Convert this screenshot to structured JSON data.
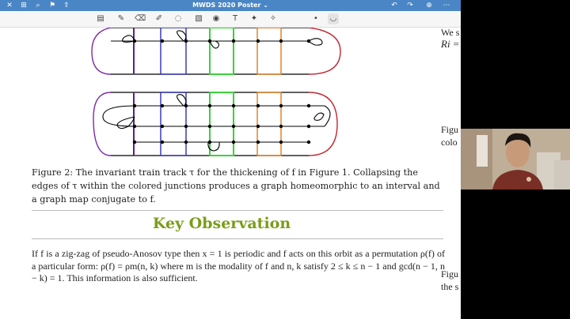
{
  "window": {
    "title": "MWDS 2020 Poster",
    "title_chevron": "⌄"
  },
  "titlebar_left": [
    {
      "name": "close-icon",
      "glyph": "✕"
    },
    {
      "name": "grid-icon",
      "glyph": "⊞"
    },
    {
      "name": "search-icon",
      "glyph": "⌕"
    },
    {
      "name": "bookmark-icon",
      "glyph": "⚑"
    },
    {
      "name": "share-icon",
      "glyph": "⇪"
    }
  ],
  "titlebar_right": [
    {
      "name": "undo-icon",
      "glyph": "↶"
    },
    {
      "name": "redo-icon",
      "glyph": "↷"
    },
    {
      "name": "add-page-icon",
      "glyph": "⊕"
    },
    {
      "name": "more-icon",
      "glyph": "⋯"
    }
  ],
  "toolbar": [
    {
      "name": "reader-icon",
      "glyph": "▤"
    },
    {
      "name": "pen-icon",
      "glyph": "✎"
    },
    {
      "name": "eraser-icon",
      "glyph": "⌫"
    },
    {
      "name": "highlighter-icon",
      "glyph": "✐"
    },
    {
      "name": "lasso-icon",
      "glyph": "◌"
    },
    {
      "name": "image-icon",
      "glyph": "▧"
    },
    {
      "name": "camera-icon",
      "glyph": "◉"
    },
    {
      "name": "text-icon",
      "glyph": "T"
    },
    {
      "name": "laser-icon",
      "glyph": "✦"
    },
    {
      "name": "color-dot-icon",
      "glyph": "•"
    },
    {
      "name": "thickness-icon",
      "glyph": "◡"
    }
  ],
  "caption": "Figure 2: The invariant train track τ for the thickening of f in Figure 1. Collapsing the edges of τ within the colored junctions produces a graph homeomorphic to an interval and a graph map conjugate to f.",
  "key_observation": "Key Observation",
  "body": "If f is a zig-zag of pseudo-Anosov type then x = 1 is periodic and f acts on this orbit as a permutation ρ(f) of a particular form: ρ(f) = ρm(n, k) where m is the modality of f and n, k satisfy 2 ≤ k ≤ n − 1 and gcd(n − 1, n − k) = 1. This information is also sufficient.",
  "right_column": {
    "line1": "We s",
    "line2": "Ri =",
    "line3": "Figu",
    "line4": "colo",
    "line5": "Figu",
    "line6": "the s"
  },
  "colors": {
    "titlebar": "#4a86c5",
    "accent_green": "#7a9d1a",
    "purple_dark": "#5a1f8a",
    "purple": "#7a2aa8",
    "blue": "#2b2fb0",
    "green": "#3bd13b",
    "orange": "#e07a1a",
    "red": "#c2242f"
  }
}
